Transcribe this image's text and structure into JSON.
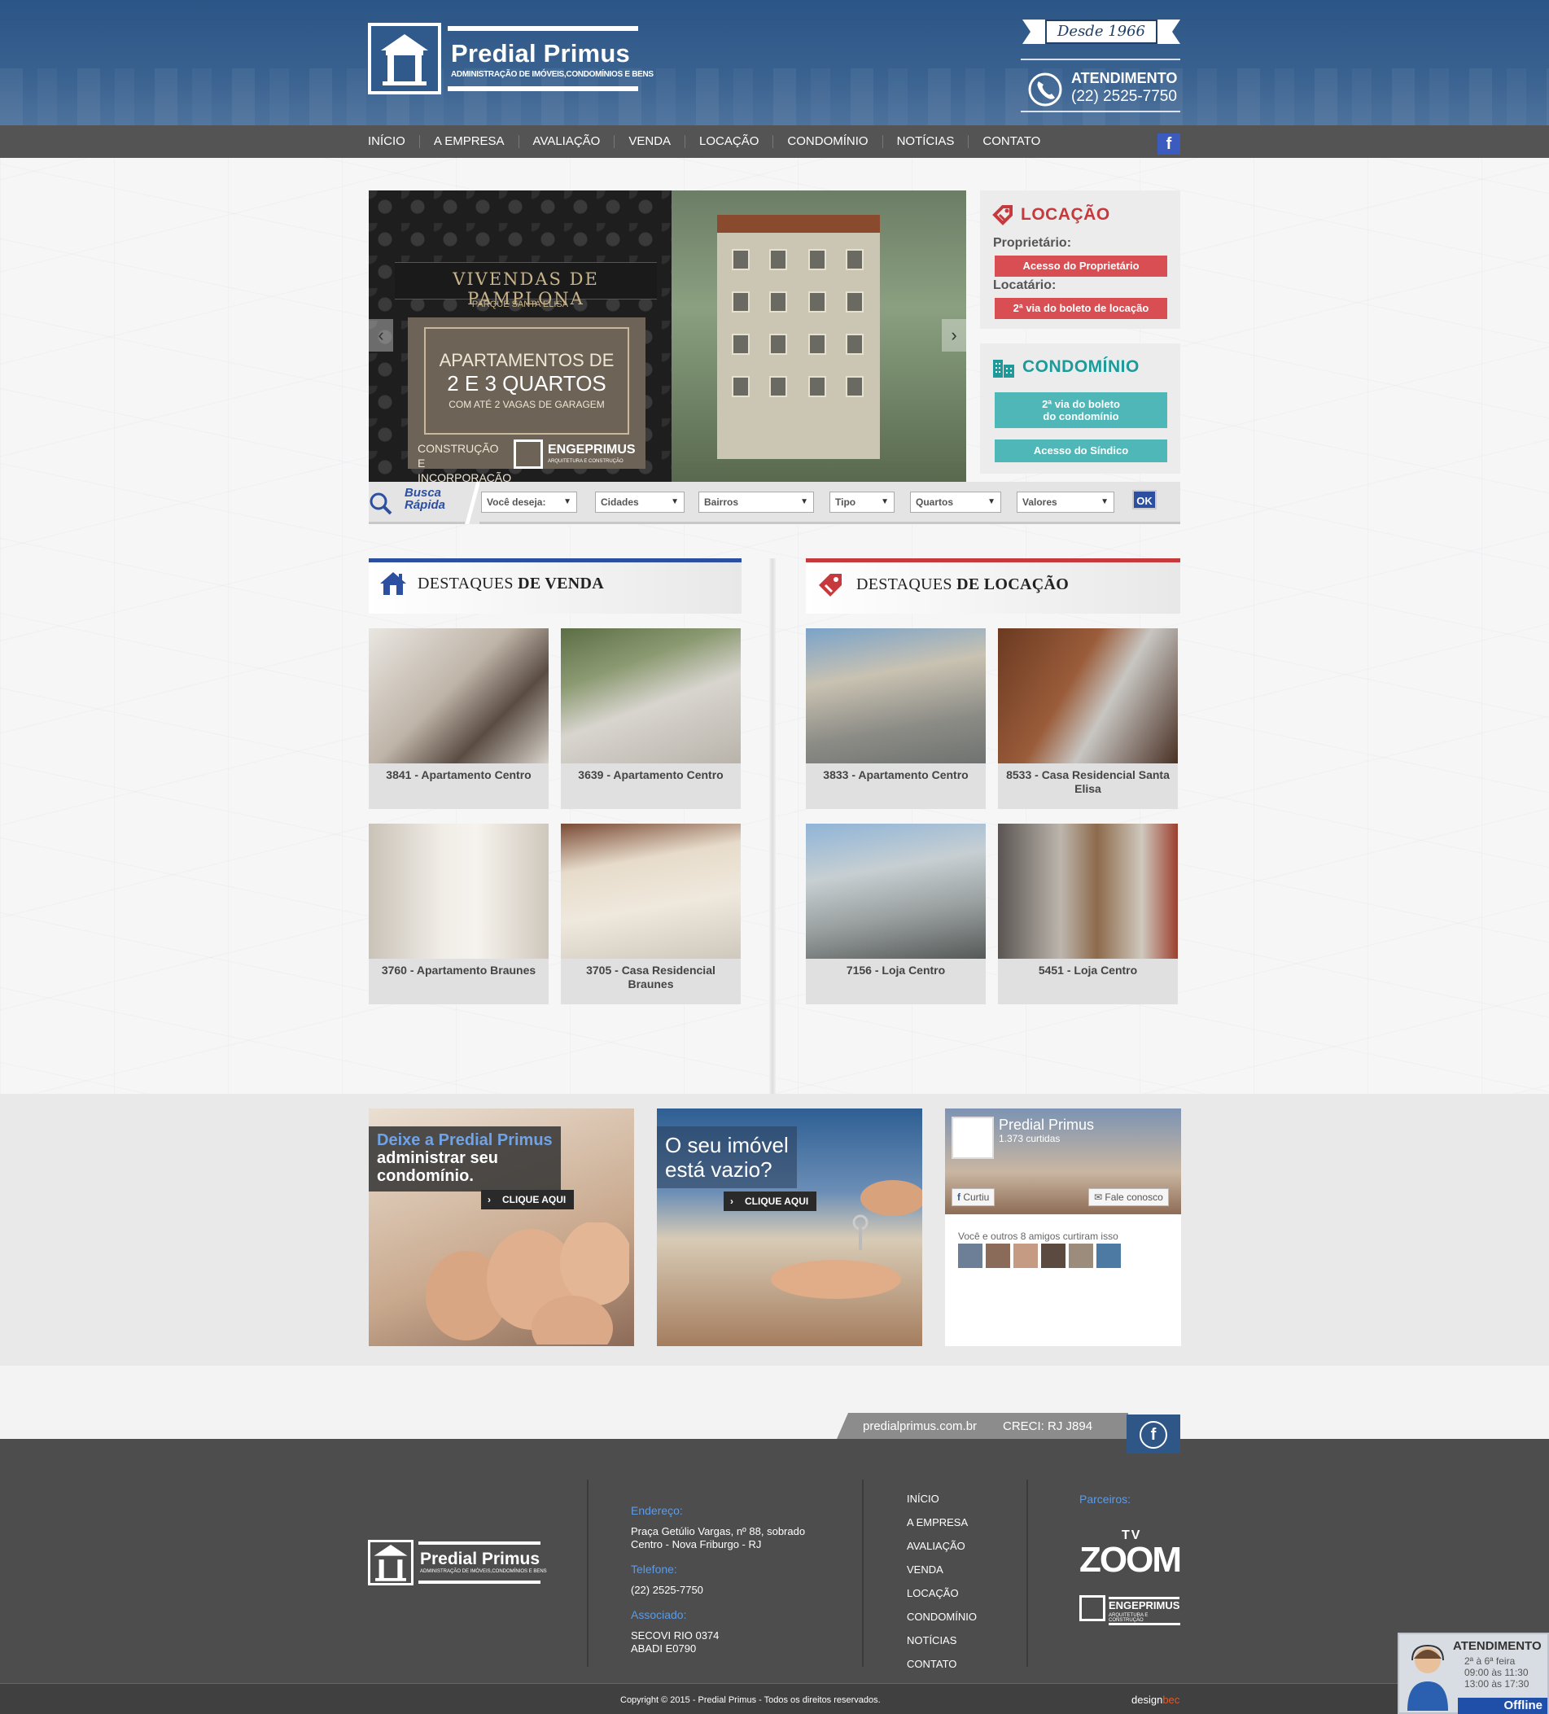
{
  "header": {
    "logo_name": "Predial Primus",
    "logo_sub": "ADMINISTRAÇÃO DE IMÓVEIS,CONDOMÍNIOS E BENS",
    "since": "Desde 1966",
    "atendimento_label": "ATENDIMENTO",
    "phone": "(22) 2525-7750"
  },
  "nav": {
    "items": [
      "INÍCIO",
      "A EMPRESA",
      "AVALIAÇÃO",
      "VENDA",
      "LOCAÇÃO",
      "CONDOMÍNIO",
      "NOTÍCIAS",
      "CONTATO"
    ],
    "facebook_icon": "facebook-icon"
  },
  "slider": {
    "title": "VIVENDAS DE PAMPLONA",
    "subtitle": "PARQUE SANTA ELISA",
    "line1": "APARTAMENTOS DE",
    "line2": "2 E 3 QUARTOS",
    "line3": "COM ATÉ 2 VAGAS DE GARAGEM",
    "line4": "CONSTRUÇÃO E INCORPORAÇÃO",
    "brand_name": "ENGEPRIMUS",
    "brand_sub": "ARQUITETURA E CONSTRUÇÃO",
    "prev": "‹",
    "next": "›"
  },
  "locacao": {
    "title": "LOCAÇÃO",
    "proprietario_label": "Proprietário:",
    "proprietario_button": "Acesso do Proprietário",
    "locatario_label": "Locatário:",
    "locatario_button": "2ª via do boleto de locação"
  },
  "condominio": {
    "title": "CONDOMÍNIO",
    "boleto_button_l1": "2ª via do boleto",
    "boleto_button_l2": "do condomínio",
    "sindico_button": "Acesso do Síndico"
  },
  "busca": {
    "label_l1": "Busca",
    "label_l2": "Rápida",
    "selects": [
      "Você deseja:",
      "Cidades",
      "Bairros",
      "Tipo",
      "Quartos",
      "Valores"
    ],
    "ok": "OK"
  },
  "destaques_venda": {
    "title_plain": "DESTAQUES ",
    "title_bold": "DE VENDA",
    "items": [
      "3841 - Apartamento Centro",
      "3639 - Apartamento Centro",
      "3760 - Apartamento Braunes",
      "3705 - Casa Residencial Braunes"
    ]
  },
  "destaques_locacao": {
    "title_plain": "DESTAQUES ",
    "title_bold": "DE LOCAÇÃO",
    "items": [
      "3833 - Apartamento Centro",
      "8533 - Casa Residencial Santa Elisa",
      "7156 - Loja Centro",
      "5451 - Loja Centro"
    ]
  },
  "promos": {
    "condominio_t1": "Deixe a Predial Primus",
    "condominio_t2": "administrar seu",
    "condominio_t3": "condomínio.",
    "cta1": "CLIQUE AQUI",
    "vazio_t1": "O seu imóvel",
    "vazio_t2": "está vazio?",
    "cta2": "CLIQUE AQUI"
  },
  "facebook_box": {
    "page_name": "Predial Primus",
    "likes": "1.373 curtidas",
    "curtiu": "Curtiu",
    "fale": "Fale conosco",
    "friends": "Você e outros 8 amigos curtiram isso"
  },
  "strip": {
    "site": "predialprimus.com.br",
    "creci": "CRECI: RJ J894"
  },
  "footer": {
    "logo_name": "Predial Primus",
    "logo_sub": "ADMINISTRAÇÃO DE IMÓVEIS,CONDOMÍNIOS E BENS",
    "endereco_label": "Endereço:",
    "endereco_l1": "Praça Getúlio Vargas, nº 88, sobrado",
    "endereco_l2": "Centro - Nova Friburgo - RJ",
    "telefone_label": "Telefone:",
    "telefone": "(22) 2525-7750",
    "associado_label": "Associado:",
    "associado_l1": "SECOVI RIO 0374",
    "associado_l2": "ABADI E0790",
    "links": [
      "INÍCIO",
      "A EMPRESA",
      "AVALIAÇÃO",
      "VENDA",
      "LOCAÇÃO",
      "CONDOMÍNIO",
      "NOTÍCIAS",
      "CONTATO"
    ],
    "parceiros_label": "Parceiros:",
    "tv_small": "TV",
    "tv_big": "ZOOM",
    "enge_name": "ENGEPRIMUS",
    "enge_sub": "ARQUITETURA E CONSTRUÇÃO",
    "copyright": "Copyright © 2015 - Predial Primus - Todos os direitos reservados.",
    "designbec_a": "design",
    "designbec_b": "bec"
  },
  "chat": {
    "title": "ATENDIMENTO",
    "l1": "2ª à 6ª feira",
    "l2": "09:00 às 11:30",
    "l3": "13:00 às 17:30",
    "status": "Offline"
  },
  "colors": {
    "brand_blue": "#2c4fa0",
    "header_blue": "#3a6290",
    "locacao_red": "#d94e52",
    "condominio_teal": "#4fb7b7"
  }
}
